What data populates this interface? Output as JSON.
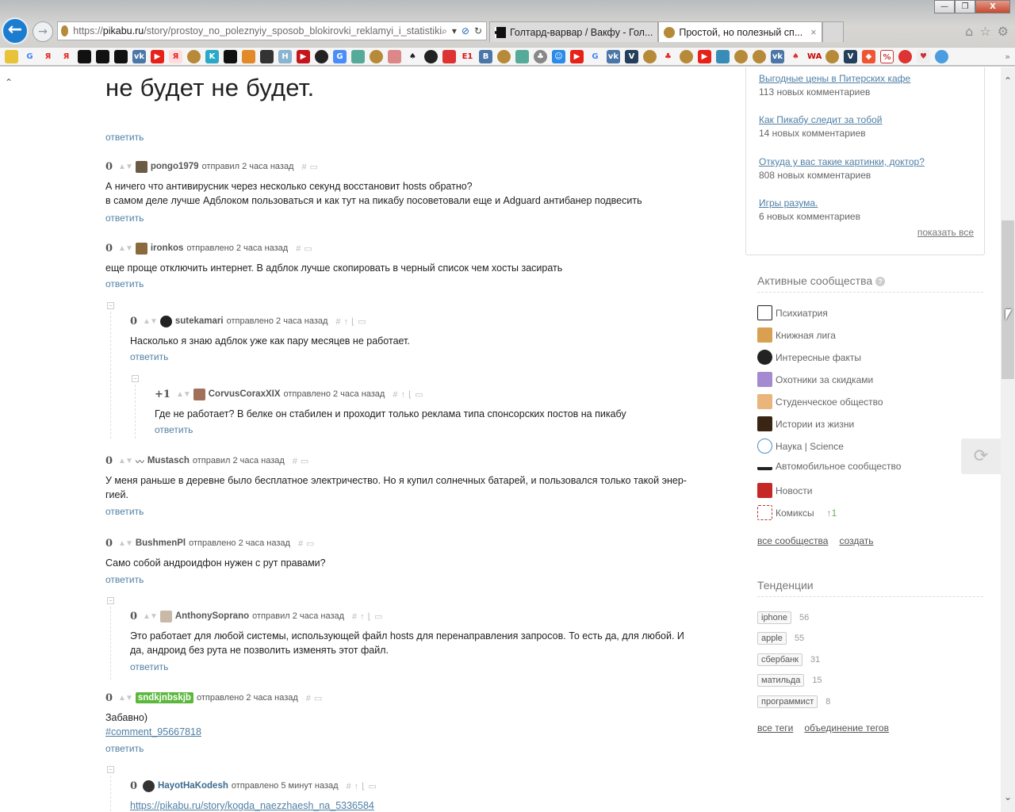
{
  "browser": {
    "window_controls": {
      "minimize": "—",
      "restore": "❐",
      "close": "X"
    },
    "url_host": "pikabu.ru",
    "url_prefix": "https://",
    "url_path": "/story/prostoy_no_poleznyiy_sposob_blokirovki_reklamyi_i_statistiki",
    "tabs": [
      {
        "title": "Голтард-варвар / Вакфу - Гол...",
        "active": false
      },
      {
        "title": "Простой, но полезный сп...",
        "active": true
      }
    ],
    "tab_close": "×",
    "favorites_more": "»"
  },
  "post": {
    "image_text": "не будет не будет.",
    "reply_label": "ответить"
  },
  "comments": [
    {
      "score": "0",
      "user": "pongo1979",
      "action": "отправил 2 часа назад",
      "lines": [
        "А ничего что антивирусник через  несколько секунд восстановит hosts обратно?",
        "в самом деле лучше Адблоком пользоваться и как тут на пикабу посоветовали еще и Adguard антибанер подвесить"
      ],
      "reply": "ответить"
    },
    {
      "score": "0",
      "user": "ironkos",
      "action": "отправлено 2 часа назад",
      "lines": [
        "еще проще отключить интернет. В адблок лучше скопировать в черный список чем хосты засирать"
      ],
      "reply": "ответить"
    },
    {
      "score": "0",
      "user": "sutekamari",
      "action": "отправлено 2 часа назад",
      "lines": [
        "Насколько я знаю адблок уже как пару месяцев не работает."
      ],
      "reply": "ответить"
    },
    {
      "score": "+1",
      "user": "CorvusCoraxXIX",
      "action": "отправлено 2 часа назад",
      "lines": [
        "Где не работает? В белке он стабилен и проходит только реклама типа спонсорских постов на пикабу"
      ],
      "reply": "ответить"
    },
    {
      "score": "0",
      "user": "Mustasch",
      "action": "отправил 2 часа назад",
      "lines": [
        "У меня раньше в деревне было бесплатное электричество. Но я купил солнечных батарей, и пользовался только такой энер-",
        "гией."
      ],
      "reply": "ответить"
    },
    {
      "score": "0",
      "user": "BushmenPl",
      "action": "отправлено 2 часа назад",
      "lines": [
        "Само собой андроидфон нужен с рут правами?"
      ],
      "reply": "ответить"
    },
    {
      "score": "0",
      "user": "AnthonySoprano",
      "action": "отправил 2 часа назад",
      "lines": [
        "Это работает для любой системы, использующей файл hosts для перенаправления запросов. То есть да, для любой. И",
        "да, андроид без рута не позволить изменять этот файл."
      ],
      "reply": "ответить"
    },
    {
      "score": "0",
      "user": "sndkjnbskjb",
      "action": "отправлено 2 часа назад",
      "lines": [
        "Забавно)"
      ],
      "link": "#comment_95667818",
      "reply": "ответить"
    },
    {
      "score": "0",
      "user": "HayotHaKodesh",
      "action": "отправлено 5 минут назад",
      "link": "https://pikabu.ru/story/kogda_naezzhaesh_na_5336584"
    }
  ],
  "comment_tools": {
    "hash": "#",
    "up": "↑",
    "branch": "⌊",
    "save": "▭"
  },
  "sidebar": {
    "hot": [
      {
        "title": "Выгодные цены в Питерских кафе",
        "count": "113 новых комментариев"
      },
      {
        "title": "Как Пикабу следит за тобой",
        "count": "14 новых комментариев"
      },
      {
        "title": "Откуда у вас такие картинки, доктор?",
        "count": "808 новых комментариев"
      },
      {
        "title": "Игры разума.",
        "count": "6 новых комментариев"
      }
    ],
    "show_all": "показать все",
    "communities_title": "Активные сообщества",
    "communities": [
      {
        "name": "Психиатрия"
      },
      {
        "name": "Книжная лига"
      },
      {
        "name": "Интересные факты"
      },
      {
        "name": "Охотники за скидками"
      },
      {
        "name": "Студенческое общество"
      },
      {
        "name": "Истории из жизни"
      },
      {
        "name": "Наука | Science"
      },
      {
        "name": "Автомобильное сообщество"
      },
      {
        "name": "Новости"
      },
      {
        "name": "Комиксы",
        "badge": "↑1"
      }
    ],
    "all_communities": "все сообщества",
    "create": "создать",
    "trends_title": "Тенденции",
    "tags": [
      {
        "tag": "iphone",
        "count": "56"
      },
      {
        "tag": "apple",
        "count": "55"
      },
      {
        "tag": "сбербанк",
        "count": "31"
      },
      {
        "tag": "матильда",
        "count": "15"
      },
      {
        "tag": "программист",
        "count": "8"
      }
    ],
    "all_tags": "все теги",
    "merge_tags": "объединение тегов"
  },
  "colors": {
    "link": "#4f7fa5",
    "accent_green": "#5bb83d",
    "ie_blue": "#1c7dd0"
  }
}
